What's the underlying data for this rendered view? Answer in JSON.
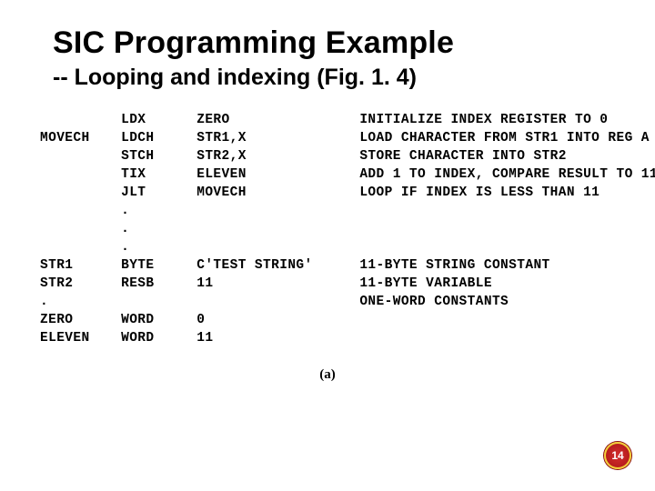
{
  "title": "SIC Programming Example",
  "subtitle": "-- Looping and indexing (Fig. 1. 4)",
  "caption": "(a)",
  "page_number": "14",
  "code": {
    "rows": [
      {
        "label": "",
        "opcode": "LDX",
        "operand": "ZERO",
        "comment": "INITIALIZE INDEX REGISTER TO 0"
      },
      {
        "label": "MOVECH",
        "opcode": "LDCH",
        "operand": "STR1,X",
        "comment": "LOAD CHARACTER FROM STR1 INTO REG A"
      },
      {
        "label": "",
        "opcode": "STCH",
        "operand": "STR2,X",
        "comment": "STORE CHARACTER INTO STR2"
      },
      {
        "label": "",
        "opcode": "TIX",
        "operand": "ELEVEN",
        "comment": "ADD 1 TO INDEX, COMPARE RESULT TO 11"
      },
      {
        "label": "",
        "opcode": "JLT",
        "operand": "MOVECH",
        "comment": "LOOP IF INDEX IS LESS THAN 11"
      },
      {
        "label": "",
        "opcode": ".",
        "operand": "",
        "comment": ""
      },
      {
        "label": "",
        "opcode": ".",
        "operand": "",
        "comment": ""
      },
      {
        "label": "",
        "opcode": ".",
        "operand": "",
        "comment": ""
      },
      {
        "label": "STR1",
        "opcode": "BYTE",
        "operand": "C'TEST STRING'",
        "comment": "11-BYTE STRING CONSTANT"
      },
      {
        "label": "STR2",
        "opcode": "RESB",
        "operand": "11",
        "comment": "11-BYTE VARIABLE"
      },
      {
        "label": ".",
        "opcode": "",
        "operand": "",
        "comment": "ONE-WORD CONSTANTS"
      },
      {
        "label": "ZERO",
        "opcode": "WORD",
        "operand": "0",
        "comment": ""
      },
      {
        "label": "ELEVEN",
        "opcode": "WORD",
        "operand": "11",
        "comment": ""
      }
    ]
  }
}
